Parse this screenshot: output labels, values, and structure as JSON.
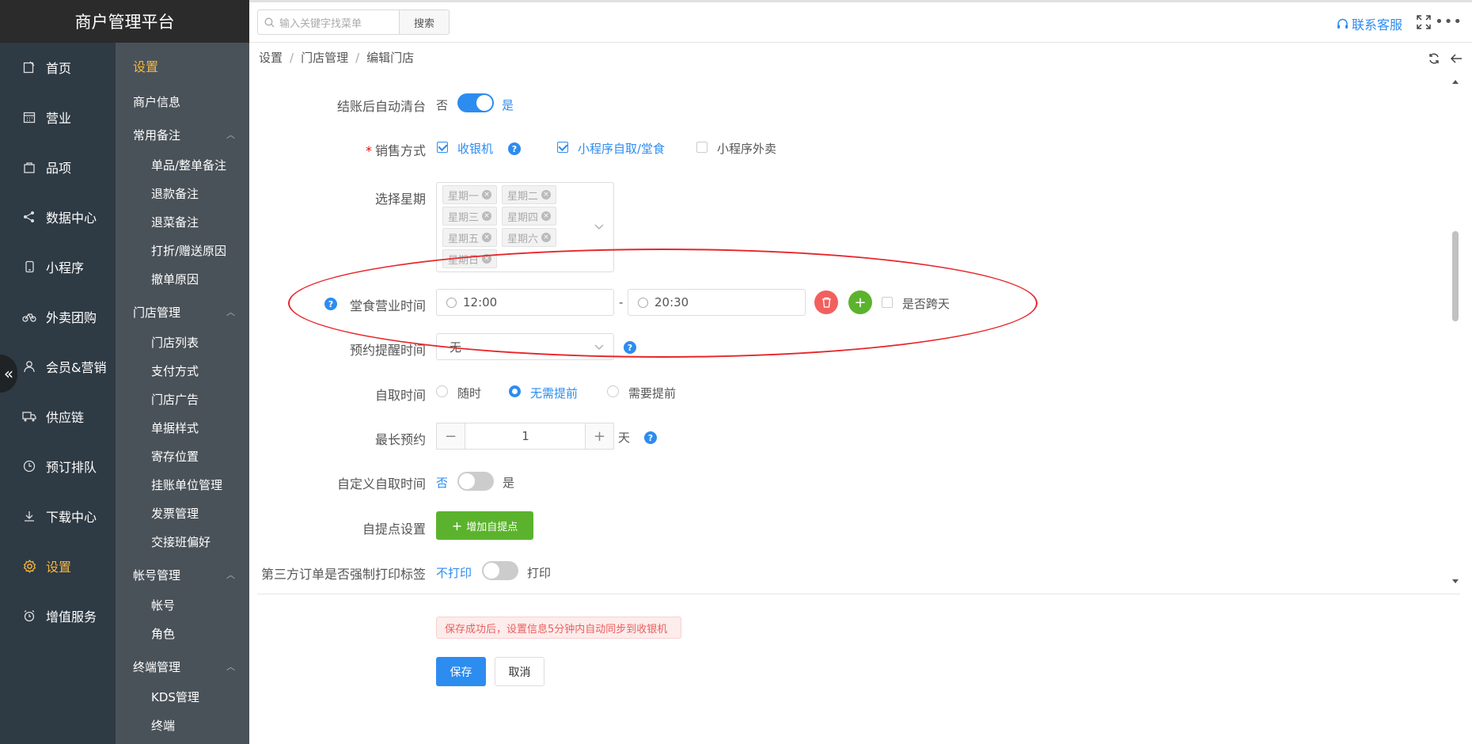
{
  "app": {
    "title": "商户管理平台"
  },
  "nav": {
    "items": [
      {
        "label": "首页",
        "icon": "edit-icon"
      },
      {
        "label": "营业",
        "icon": "calendar-icon"
      },
      {
        "label": "品项",
        "icon": "bag-icon"
      },
      {
        "label": "数据中心",
        "icon": "share-icon"
      },
      {
        "label": "小程序",
        "icon": "phone-icon"
      },
      {
        "label": "外卖团购",
        "icon": "bike-icon"
      },
      {
        "label": "会员&营销",
        "icon": "user-icon"
      },
      {
        "label": "供应链",
        "icon": "truck-icon"
      },
      {
        "label": "预订排队",
        "icon": "clock-icon"
      },
      {
        "label": "下载中心",
        "icon": "download-icon"
      },
      {
        "label": "设置",
        "icon": "gear-icon"
      },
      {
        "label": "增值服务",
        "icon": "alarm-icon"
      }
    ],
    "active": "设置"
  },
  "subnav": {
    "title": "设置",
    "merchant_info": "商户信息",
    "groups": [
      {
        "label": "常用备注",
        "items": [
          "单品/整单备注",
          "退款备注",
          "退菜备注",
          "打折/赠送原因",
          "撤单原因"
        ]
      },
      {
        "label": "门店管理",
        "items": [
          "门店列表",
          "支付方式",
          "门店广告",
          "单据样式",
          "寄存位置",
          "挂账单位管理",
          "发票管理",
          "交接班偏好"
        ]
      },
      {
        "label": "帐号管理",
        "items": [
          "帐号",
          "角色"
        ]
      },
      {
        "label": "终端管理",
        "items": [
          "KDS管理",
          "终端"
        ]
      }
    ]
  },
  "topbar": {
    "search_placeholder": "输入关键字找菜单",
    "search_button": "搜索",
    "contact": "联系客服"
  },
  "breadcrumb": [
    "设置",
    "门店管理",
    "编辑门店"
  ],
  "form": {
    "auto_clear": {
      "label": "结账后自动清台",
      "off": "否",
      "on": "是",
      "value": true
    },
    "sale_mode": {
      "label": "销售方式",
      "options": [
        {
          "label": "收银机",
          "checked": true
        },
        {
          "label": "小程序自取/堂食",
          "checked": true
        },
        {
          "label": "小程序外卖",
          "checked": false
        }
      ]
    },
    "weekdays": {
      "label": "选择星期",
      "tags": [
        "星期一",
        "星期二",
        "星期三",
        "星期四",
        "星期五",
        "星期六",
        "星期日"
      ]
    },
    "dine_hours": {
      "label": "堂食营业时间",
      "start": "12:00",
      "end": "20:30",
      "dash": "-",
      "overnight_label": "是否跨天",
      "overnight": false
    },
    "reminder": {
      "label": "预约提醒时间",
      "value": "无"
    },
    "pickup_time": {
      "label": "自取时间",
      "options": [
        "随时",
        "无需提前",
        "需要提前"
      ],
      "selected": "无需提前"
    },
    "max_booking": {
      "label": "最长预约",
      "value": "1",
      "unit": "天"
    },
    "custom_pickup": {
      "label": "自定义自取时间",
      "off": "否",
      "on": "是",
      "value": false
    },
    "pickup_points": {
      "label": "自提点设置",
      "button": "增加自提点"
    },
    "third_party_print": {
      "label": "第三方订单是否强制打印标签",
      "off": "不打印",
      "on": "打印",
      "value": false
    }
  },
  "footer": {
    "notice": "保存成功后，设置信息5分钟内自动同步到收银机",
    "save": "保存",
    "cancel": "取消"
  },
  "colors": {
    "primary": "#2d8cf0",
    "active_nav": "#f6b73c",
    "success": "#5bb32d",
    "danger": "#f2605e",
    "annotation": "#e8262a"
  }
}
